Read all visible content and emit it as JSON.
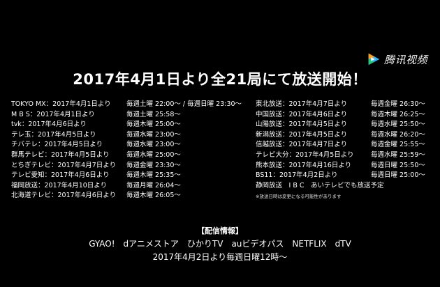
{
  "logo": {
    "text": "腾讯视频",
    "icon": "play-triangle-icon"
  },
  "headline": "2017年4月1日より全21局にて放送開始！",
  "left_schedule": [
    {
      "station": "TOKYO MX：2017年4月1日より",
      "time": "毎週土曜 22:00～ / 毎週日曜 23:30～"
    },
    {
      "station": "M B S：2017年4月1日より",
      "time": "毎週土曜 25:58～"
    },
    {
      "station": "tvk：2017年4月6日より",
      "time": "毎週木曜 25:00～"
    },
    {
      "station": "テレ玉：2017年4月5日より",
      "time": "毎週水曜 23:00～"
    },
    {
      "station": "チバテレ：2017年4月5日より",
      "time": "毎週水曜 23:00～"
    },
    {
      "station": "群馬テレビ：2017年4月5日より",
      "time": "毎週水曜 25:00～"
    },
    {
      "station": "とちぎテレビ：2017年4月7日より",
      "time": "毎週金曜 23:30～"
    },
    {
      "station": "テレビ愛知：2017年4月6日より",
      "time": "毎週木曜 25:35～"
    },
    {
      "station": "福岡放送：2017年4月10日より",
      "time": "毎週月曜 26:04～"
    },
    {
      "station": "北海道テレビ：2017年4月6日より",
      "time": "毎週木曜 26:05～"
    }
  ],
  "right_schedule": [
    {
      "station": "東北放送：2017年4月7日より",
      "time": "毎週金曜 26:30～"
    },
    {
      "station": "中国放送：2017年4月6日より",
      "time": "毎週木曜 26:25～"
    },
    {
      "station": "山陽放送：2017年4月5日より",
      "time": "毎週水曜 25:50～"
    },
    {
      "station": "新潟放送：2017年4月5日より",
      "time": "毎週水曜 26:20～"
    },
    {
      "station": "信越放送：2017年4月7日より",
      "time": "毎週金曜 25:55～"
    },
    {
      "station": "テレビ大分：2017年4月5日より",
      "time": "毎週水曜 25:59～"
    },
    {
      "station": "熊本放送：2017年4月16日より",
      "time": "毎週日曜 25:50～"
    },
    {
      "station": "BS11：2017年4月2日より",
      "time": "毎週日曜 25:00～"
    }
  ],
  "right_extra": "静岡放送　I B C　あいテレビでも放送予定",
  "note": "※放送日時は変更になる可能性があります",
  "distribution": {
    "heading": "【配信情報】",
    "services": "GYAO!　dアニメストア　ひかりTV　auビデオパス　NETFLIX　dTV",
    "schedule": "2017年4月2日より毎週日曜12時～"
  }
}
